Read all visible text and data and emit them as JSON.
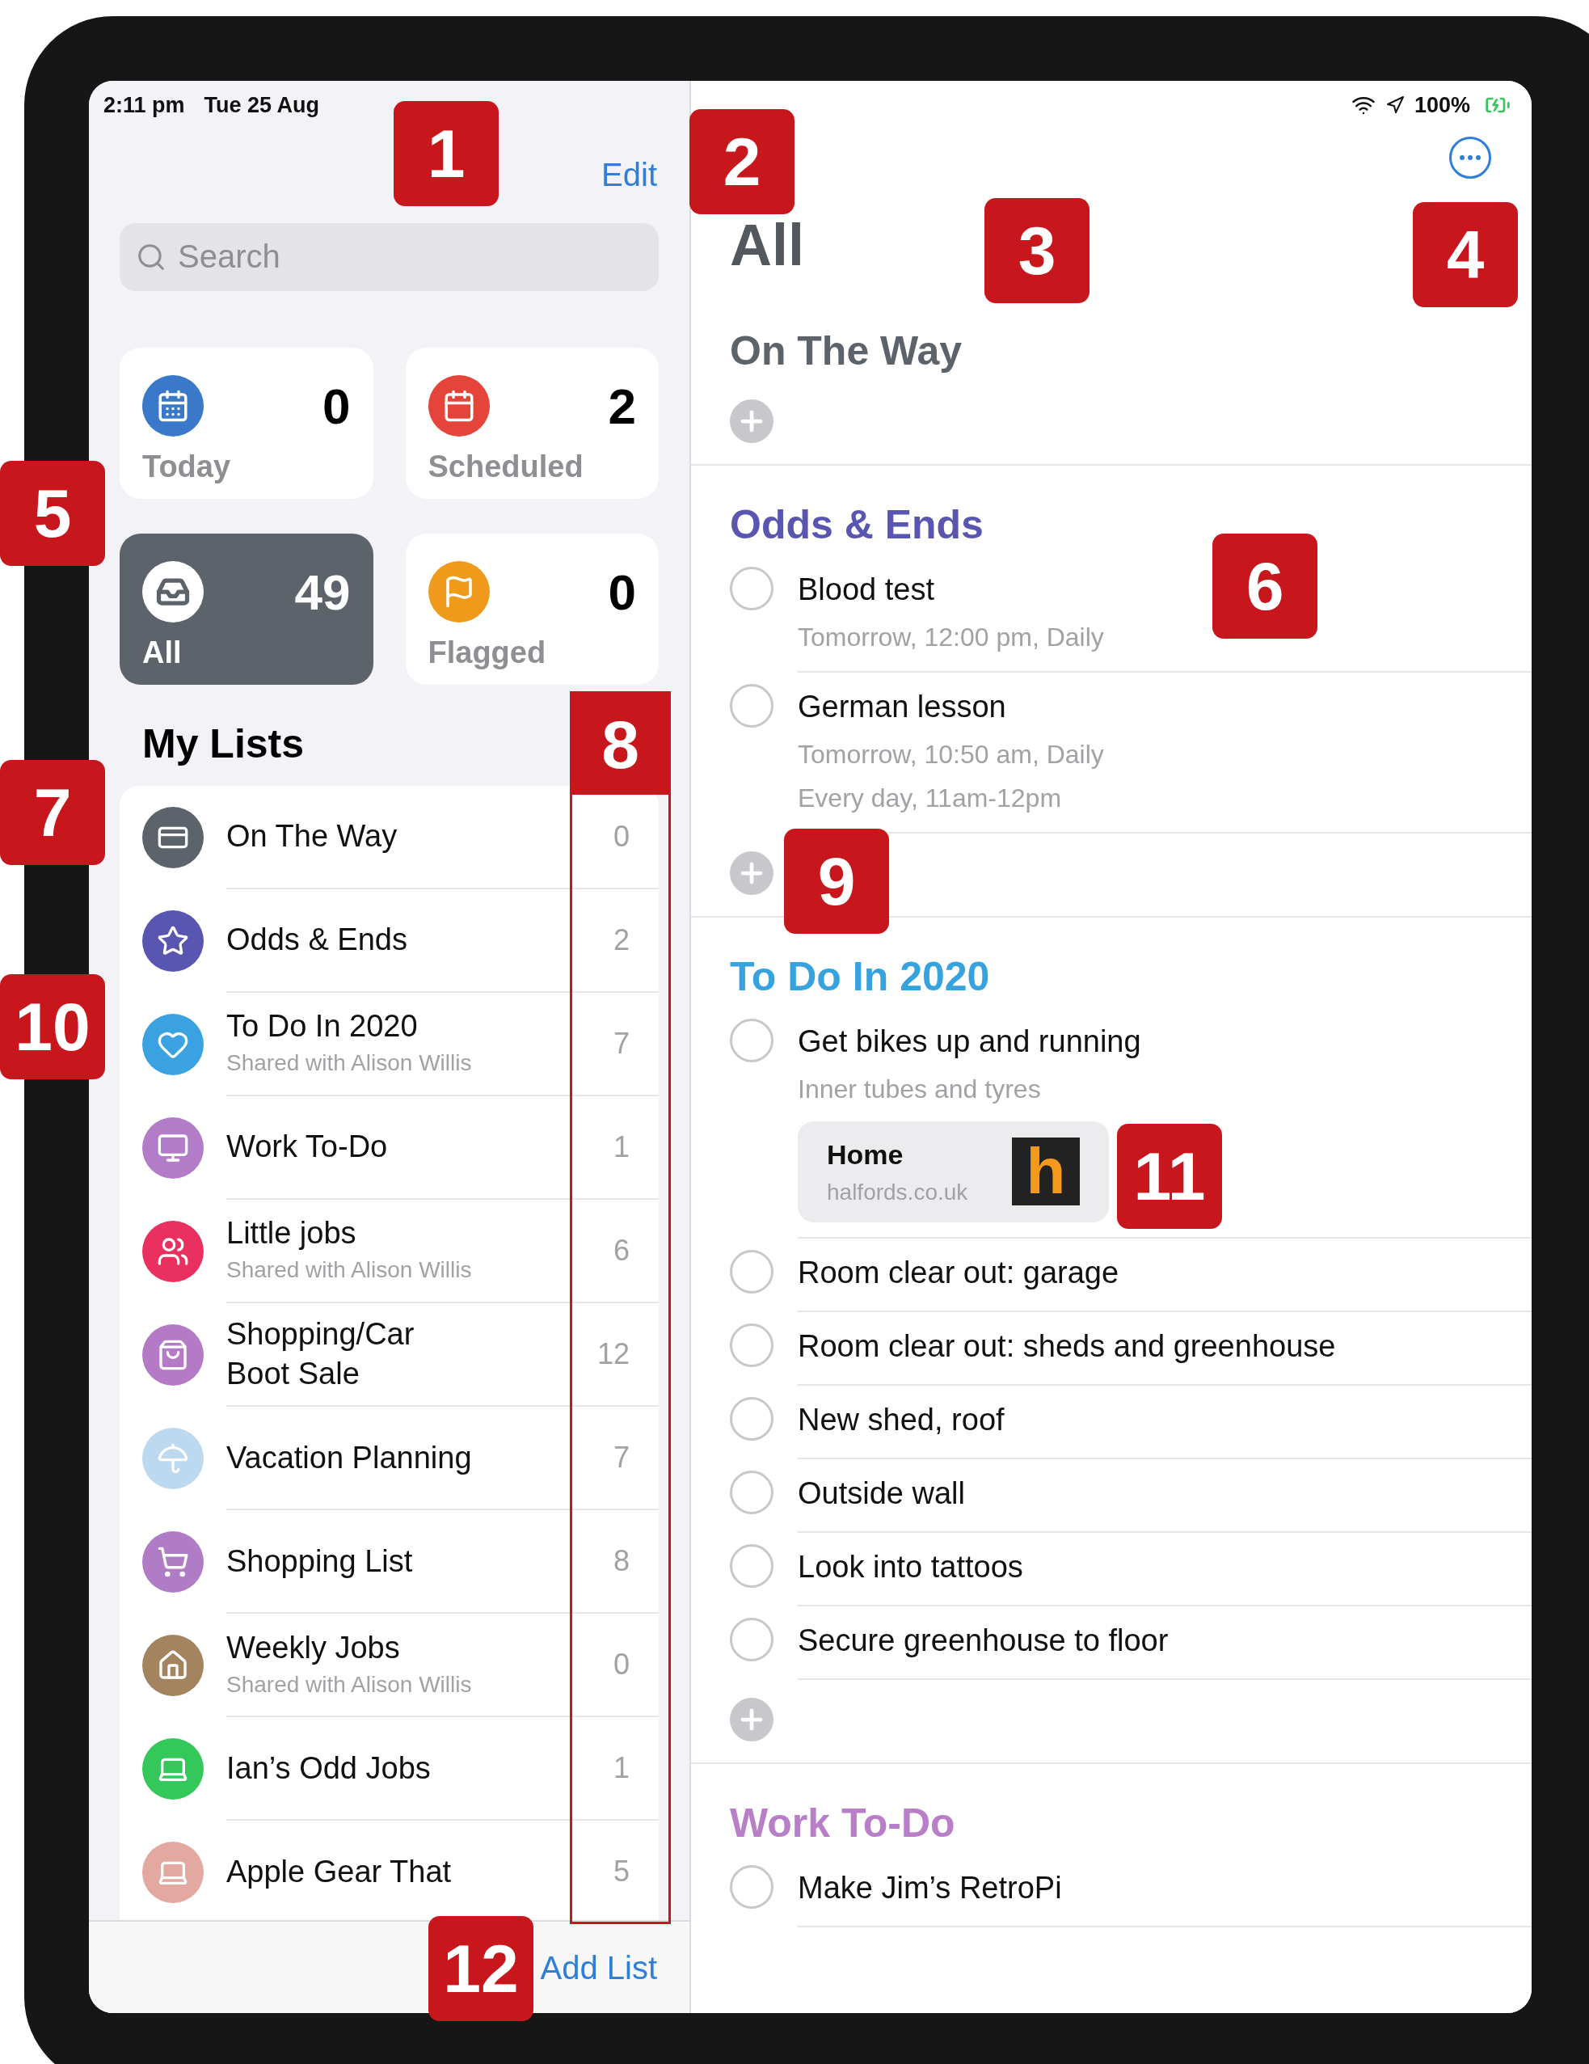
{
  "status_bar": {
    "time": "2:11 pm",
    "date": "Tue 25 Aug",
    "battery": "100%"
  },
  "sidebar": {
    "edit": "Edit",
    "search": {
      "placeholder": "Search"
    },
    "smart_lists": [
      {
        "label": "Today",
        "count": "0",
        "color": "#3a78c9",
        "selected": false
      },
      {
        "label": "Scheduled",
        "count": "2",
        "color": "#e5443b",
        "selected": false
      },
      {
        "label": "All",
        "count": "49",
        "color": "#5c636b",
        "selected": true
      },
      {
        "label": "Flagged",
        "count": "0",
        "color": "#f09a1c",
        "selected": false
      }
    ],
    "my_lists_title": "My Lists",
    "lists": [
      {
        "name": "On The Way",
        "count": "0",
        "color": "#5c636b"
      },
      {
        "name": "Odds & Ends",
        "count": "2",
        "color": "#5856b0"
      },
      {
        "name": "To Do In 2020",
        "subtitle": "Shared with Alison Willis",
        "count": "7",
        "color": "#3aa2e0"
      },
      {
        "name": "Work To-Do",
        "count": "1",
        "color": "#b27cc8"
      },
      {
        "name": "Little jobs",
        "subtitle": "Shared with Alison Willis",
        "count": "6",
        "color": "#e9305f"
      },
      {
        "name": "Shopping/Car\nBoot Sale",
        "count": "12",
        "color": "#b47ac6"
      },
      {
        "name": "Vacation Planning",
        "count": "7",
        "color": "#bcd9ef"
      },
      {
        "name": "Shopping List",
        "count": "8",
        "color": "#b07cc6"
      },
      {
        "name": "Weekly Jobs",
        "subtitle": "Shared with Alison Willis",
        "count": "0",
        "color": "#a3845f"
      },
      {
        "name": "Ian’s Odd Jobs",
        "count": "1",
        "color": "#34c759"
      },
      {
        "name": "Apple Gear That",
        "count": "5",
        "color": "#e3a8a0"
      }
    ],
    "add_list": "Add List"
  },
  "main": {
    "title": "All",
    "sections": [
      {
        "title": "On The Way",
        "color": "#5c636b",
        "add_button": true
      },
      {
        "title": "Odds & Ends",
        "color": "#5856b0",
        "add_button": true,
        "tasks": [
          {
            "title": "Blood test",
            "completed": false,
            "notes": [
              "Tomorrow, 12:00 pm, Daily"
            ]
          },
          {
            "title": "German lesson",
            "completed": false,
            "notes": [
              "Tomorrow, 10:50 am, Daily",
              "Every day, 11am-12pm"
            ]
          }
        ]
      },
      {
        "title": "To Do In 2020",
        "color": "#36a3df",
        "add_button": true,
        "tasks": [
          {
            "title": "Get bikes up and running",
            "completed": false,
            "notes": [
              "Inner tubes and tyres"
            ],
            "link": {
              "title": "Home",
              "domain": "halfords.co.uk",
              "logo": "h"
            }
          },
          {
            "title": "Room clear out: garage",
            "completed": false
          },
          {
            "title": "Room clear out: sheds and greenhouse",
            "completed": false
          },
          {
            "title": "New shed, roof",
            "completed": false
          },
          {
            "title": "Outside wall",
            "completed": false
          },
          {
            "title": "Look into tattoos",
            "completed": false
          },
          {
            "title": "Secure greenhouse to floor",
            "completed": false
          }
        ]
      },
      {
        "title": "Work To-Do",
        "color": "#b87fc8",
        "add_button": false,
        "tasks": [
          {
            "title": "Make Jim’s RetroPi",
            "completed": false
          }
        ]
      }
    ]
  },
  "callouts": [
    {
      "number": "1",
      "kind": "badge"
    },
    {
      "number": "2",
      "kind": "badge"
    },
    {
      "number": "3",
      "kind": "badge"
    },
    {
      "number": "4",
      "kind": "badge"
    },
    {
      "number": "5",
      "kind": "badge"
    },
    {
      "number": "6",
      "kind": "badge"
    },
    {
      "number": "7",
      "kind": "badge"
    },
    {
      "number": "8",
      "kind": "column"
    },
    {
      "number": "9",
      "kind": "badge"
    },
    {
      "number": "10",
      "kind": "badge"
    },
    {
      "number": "11",
      "kind": "badge"
    },
    {
      "number": "12",
      "kind": "badge"
    }
  ]
}
